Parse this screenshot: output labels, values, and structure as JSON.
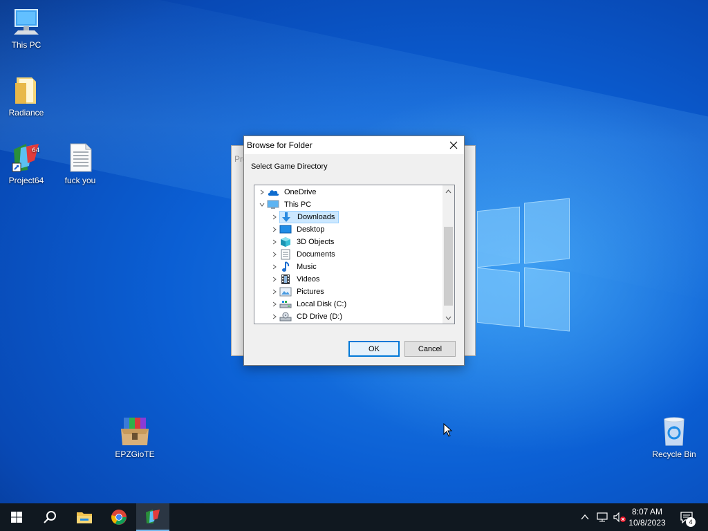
{
  "desktop": {
    "icons": [
      {
        "label": "This PC",
        "icon": "computer-icon"
      },
      {
        "label": "Radiance",
        "icon": "folder-icon"
      },
      {
        "label": "Project64",
        "icon": "project64-shortcut-icon"
      },
      {
        "label": "fuck you",
        "icon": "text-document-icon"
      },
      {
        "label": "EPZGioTE",
        "icon": "winrar-archive-icon"
      },
      {
        "label": "Recycle Bin",
        "icon": "recycle-bin-icon"
      }
    ]
  },
  "background_dialog": {
    "title": "Pro"
  },
  "dialog": {
    "title": "Browse for Folder",
    "prompt": "Select Game Directory",
    "tree": [
      {
        "label": "OneDrive",
        "icon": "onedrive-cloud-icon",
        "level": 0,
        "expanded": false,
        "selected": false
      },
      {
        "label": "This PC",
        "icon": "computer-icon",
        "level": 0,
        "expanded": true,
        "selected": false
      },
      {
        "label": "Downloads",
        "icon": "downloads-arrow-icon",
        "level": 1,
        "expanded": false,
        "selected": true
      },
      {
        "label": "Desktop",
        "icon": "desktop-icon",
        "level": 1,
        "expanded": false,
        "selected": false
      },
      {
        "label": "3D Objects",
        "icon": "3d-objects-icon",
        "level": 1,
        "expanded": false,
        "selected": false
      },
      {
        "label": "Documents",
        "icon": "documents-icon",
        "level": 1,
        "expanded": false,
        "selected": false
      },
      {
        "label": "Music",
        "icon": "music-note-icon",
        "level": 1,
        "expanded": false,
        "selected": false
      },
      {
        "label": "Videos",
        "icon": "videos-film-icon",
        "level": 1,
        "expanded": false,
        "selected": false
      },
      {
        "label": "Pictures",
        "icon": "pictures-icon",
        "level": 1,
        "expanded": false,
        "selected": false
      },
      {
        "label": "Local Disk (C:)",
        "icon": "local-disk-icon",
        "level": 1,
        "expanded": false,
        "selected": false
      },
      {
        "label": "CD Drive (D:)",
        "icon": "cd-drive-icon",
        "level": 1,
        "expanded": false,
        "selected": false
      }
    ],
    "ok_label": "OK",
    "cancel_label": "Cancel"
  },
  "taskbar": {
    "pinned": [
      {
        "name": "start-button",
        "icon": "windows-logo-icon"
      },
      {
        "name": "search-button",
        "icon": "search-icon"
      },
      {
        "name": "file-explorer-button",
        "icon": "file-explorer-icon"
      },
      {
        "name": "chrome-button",
        "icon": "chrome-icon"
      },
      {
        "name": "project64-taskbar-button",
        "icon": "project64-icon",
        "active": true
      }
    ],
    "clock": {
      "time": "8:07 AM",
      "date": "10/8/2023"
    },
    "notifications_count": "4"
  },
  "colors": {
    "accent": "#0078d7",
    "selection_bg": "#cce8ff",
    "taskbar_bg": "#101820"
  }
}
